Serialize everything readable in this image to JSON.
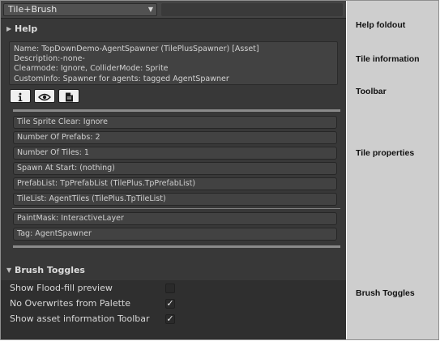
{
  "header": {
    "brush_selector": "Tile+Brush"
  },
  "help": {
    "label": "Help"
  },
  "tile_info": {
    "lines": [
      "Name: TopDownDemo-AgentSpawner (TilePlusSpawner) [Asset]",
      "Description:-none-",
      "Clearmode: Ignore, ColliderMode: Sprite",
      "CustomInfo: Spawner for agents: tagged AgentSpawner"
    ]
  },
  "toolbar": {
    "buttons": [
      {
        "icon": "info-icon"
      },
      {
        "icon": "eye-icon"
      },
      {
        "icon": "document-icon"
      }
    ]
  },
  "properties": [
    "Tile Sprite Clear: Ignore",
    "Number Of Prefabs: 2",
    "Number Of Tiles: 1",
    "Spawn At Start: (nothing)",
    "PrefabList: TpPrefabList (TilePlus.TpPrefabList)",
    "TileList: AgentTiles (TilePlus.TpTileList)",
    "PaintMask: InteractiveLayer",
    "Tag: AgentSpawner"
  ],
  "brush_toggles": {
    "label": "Brush Toggles",
    "items": [
      {
        "label": "Show Flood-fill preview",
        "checked": false
      },
      {
        "label": "No Overwrites from Palette",
        "checked": true
      },
      {
        "label": "Show asset information Toolbar",
        "checked": true
      }
    ]
  },
  "annotations": {
    "help_foldout": "Help foldout",
    "tile_information": "Tile information",
    "toolbar": "Toolbar",
    "tile_properties": "Tile properties",
    "brush_toggles": "Brush Toggles"
  }
}
